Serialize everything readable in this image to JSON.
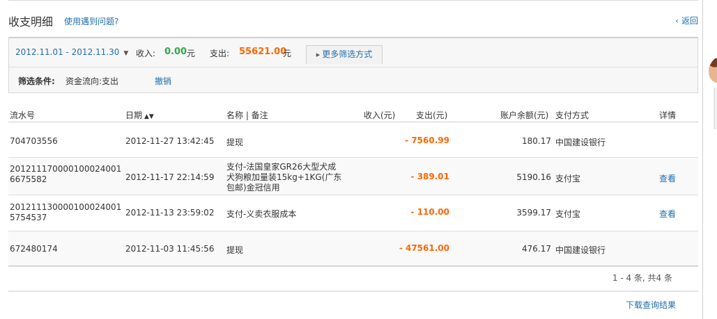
{
  "header": {
    "title": "收支明细",
    "help_link": "使用遇到问题?",
    "back_label": "返回"
  },
  "filter": {
    "date_range": "2012.11.01 - 2012.11.30",
    "income_label": "收入:",
    "income_value": "0.00",
    "income_unit": "元",
    "expense_label": "支出:",
    "expense_value": "55621.00",
    "expense_unit": "元",
    "more_filter_label": "更多筛选方式",
    "condition_label": "筛选条件:",
    "condition_value": "资金流向:支出",
    "cancel_label": "撤销"
  },
  "table": {
    "columns": {
      "serial": "流水号",
      "date": "日期",
      "name": "名称 | 备注",
      "income": "收入(元)",
      "expense": "支出(元)",
      "balance": "账户余额(元)",
      "method": "支付方式",
      "detail": "详情"
    },
    "rows": [
      {
        "serial": "704703556",
        "date": "2012-11-27 13:42:45",
        "name": "提现",
        "income": "",
        "expense": "- 7560.99",
        "balance": "180.17",
        "method": "中国建设银行",
        "detail": ""
      },
      {
        "serial": "201211170000100024001\n6675582",
        "date": "2012-11-17 22:14:59",
        "name": "支付-法国皇家GR26大型犬成犬狗粮加量装15kg+1KG(广东包邮)金冠信用",
        "income": "",
        "expense": "- 389.01",
        "balance": "5190.16",
        "method": "支付宝",
        "detail": "查看"
      },
      {
        "serial": "201211130000100024001\n5754537",
        "date": "2012-11-13 23:59:02",
        "name": "支付-义卖衣服成本",
        "income": "",
        "expense": "- 110.00",
        "balance": "3599.17",
        "method": "支付宝",
        "detail": "查看"
      },
      {
        "serial": "672480174",
        "date": "2012-11-03 11:45:56",
        "name": "提现",
        "income": "",
        "expense": "- 47561.00",
        "balance": "476.17",
        "method": "中国建设银行",
        "detail": ""
      }
    ]
  },
  "pager": {
    "summary": "1 - 4 条, 共4 条"
  },
  "footer": {
    "download_label": "下载查询结果"
  },
  "colors": {
    "link": "#1f6eae",
    "income": "#2eaa47",
    "expense": "#ff6600"
  },
  "icons": [
    "chevron-left-icon",
    "caret-down-icon",
    "triangle-right-icon",
    "sort-icon",
    "avatar-icon"
  ]
}
